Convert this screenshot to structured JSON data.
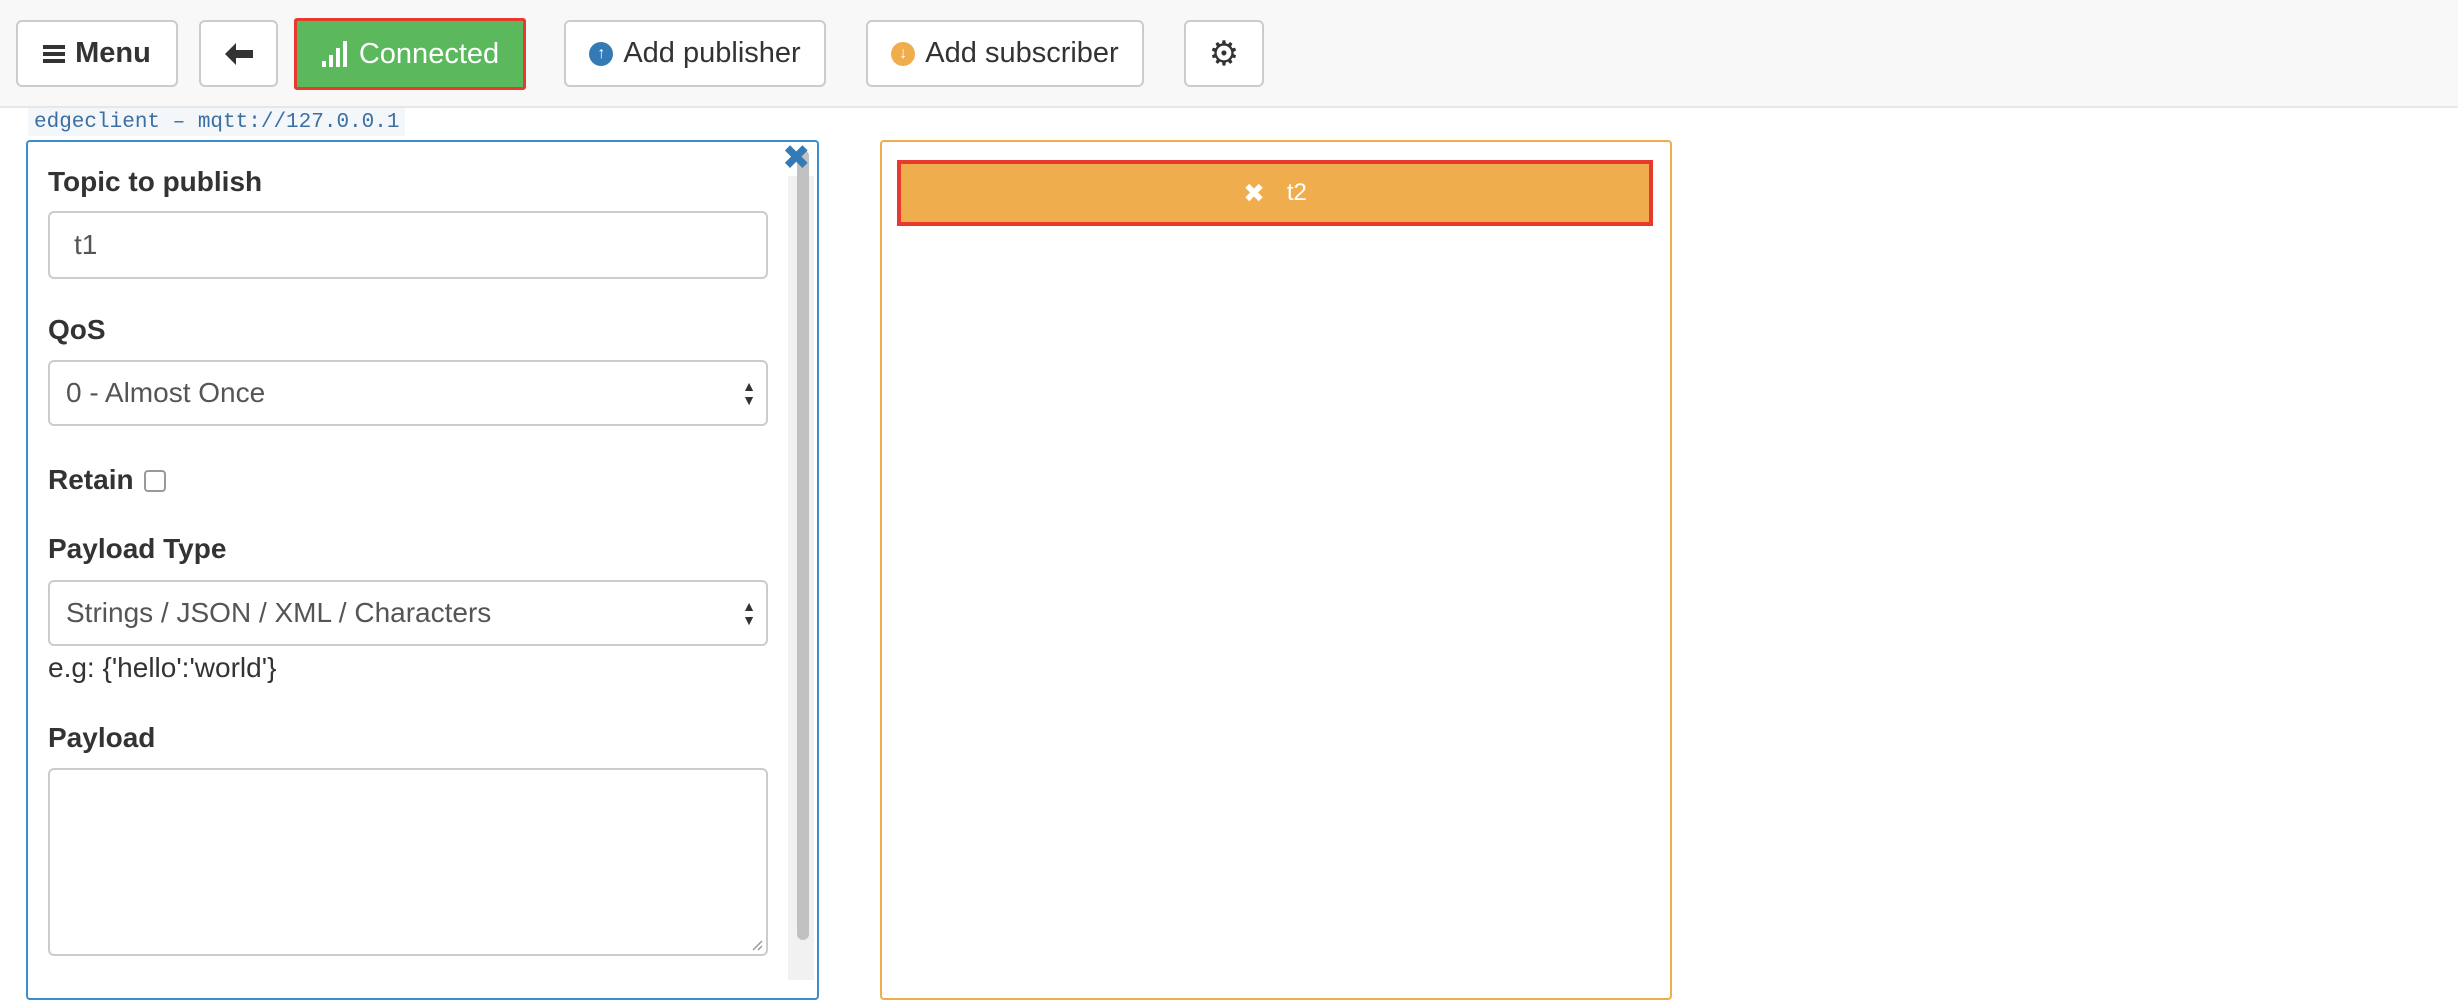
{
  "toolbar": {
    "menu_label": "Menu",
    "connected_label": "Connected",
    "add_publisher_label": "Add publisher",
    "add_subscriber_label": "Add subscriber"
  },
  "connection": {
    "tag": "edgeclient – mqtt://127.0.0.1"
  },
  "publisher": {
    "topic_label": "Topic to publish",
    "topic_value": "t1",
    "qos_label": "QoS",
    "qos_value": "0 - Almost Once",
    "retain_label": "Retain",
    "retain_checked": false,
    "payload_type_label": "Payload Type",
    "payload_type_value": "Strings / JSON / XML / Characters",
    "payload_hint": "e.g: {'hello':'world'}",
    "payload_label": "Payload",
    "payload_value": ""
  },
  "subscriber": {
    "topic": "t2"
  },
  "colors": {
    "connected_green": "#5cb85c",
    "publisher_blue": "#3c8dcb",
    "subscriber_orange": "#f0ad4e",
    "highlight_red": "#e8392e"
  },
  "icons": {
    "menu": "hamburger-icon",
    "back": "arrow-left-icon",
    "connected": "signal-bars-icon",
    "add_publisher": "arrow-up-circle-icon",
    "add_subscriber": "arrow-down-circle-icon",
    "settings": "gear-icon",
    "close_publisher": "close-icon",
    "remove_subscriber": "close-icon"
  }
}
